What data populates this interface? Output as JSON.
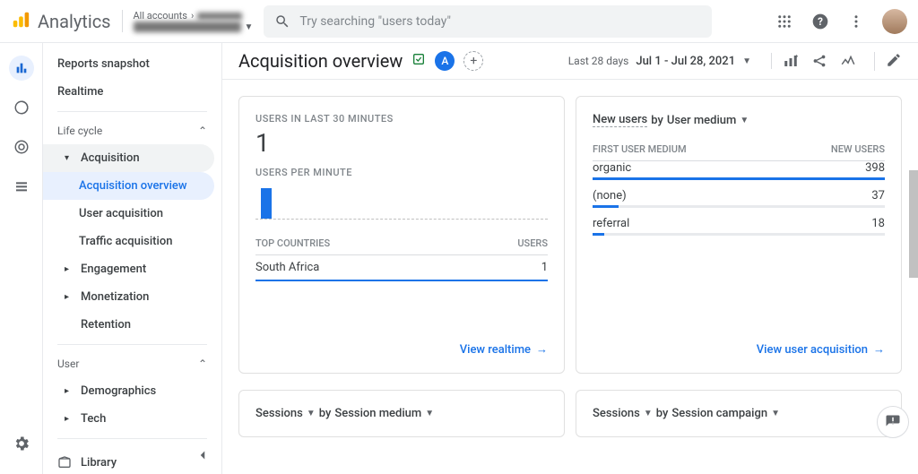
{
  "header": {
    "product": "Analytics",
    "account_line1": "All accounts",
    "search_placeholder": "Try searching \"users today\""
  },
  "sidebar": {
    "items": [
      "Reports snapshot",
      "Realtime"
    ],
    "groups": [
      {
        "label": "Life cycle",
        "children": [
          {
            "label": "Acquisition",
            "open": true,
            "children": [
              "Acquisition overview",
              "User acquisition",
              "Traffic acquisition"
            ]
          },
          {
            "label": "Engagement"
          },
          {
            "label": "Monetization"
          },
          {
            "label": "Retention",
            "leaf": true
          }
        ]
      },
      {
        "label": "User",
        "children": [
          {
            "label": "Demographics"
          },
          {
            "label": "Tech"
          }
        ]
      }
    ],
    "library": "Library"
  },
  "page": {
    "title": "Acquisition overview",
    "audience_badge": "A",
    "date_preset": "Last 28 days",
    "date_range": "Jul 1 - Jul 28, 2021"
  },
  "card_realtime": {
    "title": "USERS IN LAST 30 MINUTES",
    "value": "1",
    "per_min_label": "USERS PER MINUTE",
    "countries_label": "TOP COUNTRIES",
    "countries_unit": "USERS",
    "countries": [
      {
        "name": "South Africa",
        "value": "1"
      }
    ],
    "footer": "View realtime"
  },
  "card_newusers": {
    "metric": "New users",
    "by": "by",
    "dimension": "User medium",
    "col1": "FIRST USER MEDIUM",
    "col2": "NEW USERS",
    "rows": [
      {
        "label": "organic",
        "value": "398",
        "pct": 100
      },
      {
        "label": "(none)",
        "value": "37",
        "pct": 9
      },
      {
        "label": "referral",
        "value": "18",
        "pct": 4
      }
    ],
    "footer": "View user acquisition"
  },
  "card_sess_medium": {
    "metric": "Sessions",
    "by": "by",
    "dimension": "Session medium"
  },
  "card_sess_campaign": {
    "metric": "Sessions",
    "by": "by",
    "dimension": "Session campaign"
  },
  "chart_data": [
    {
      "type": "bar",
      "title": "Users per minute",
      "categories": [
        "m-30..m-1"
      ],
      "values_hint": "single nonzero bar near left",
      "max": 1
    },
    {
      "type": "table",
      "title": "Top countries",
      "rows": [
        [
          "South Africa",
          1
        ]
      ]
    },
    {
      "type": "bar",
      "title": "New users by User medium",
      "categories": [
        "organic",
        "(none)",
        "referral"
      ],
      "values": [
        398,
        37,
        18
      ]
    }
  ]
}
